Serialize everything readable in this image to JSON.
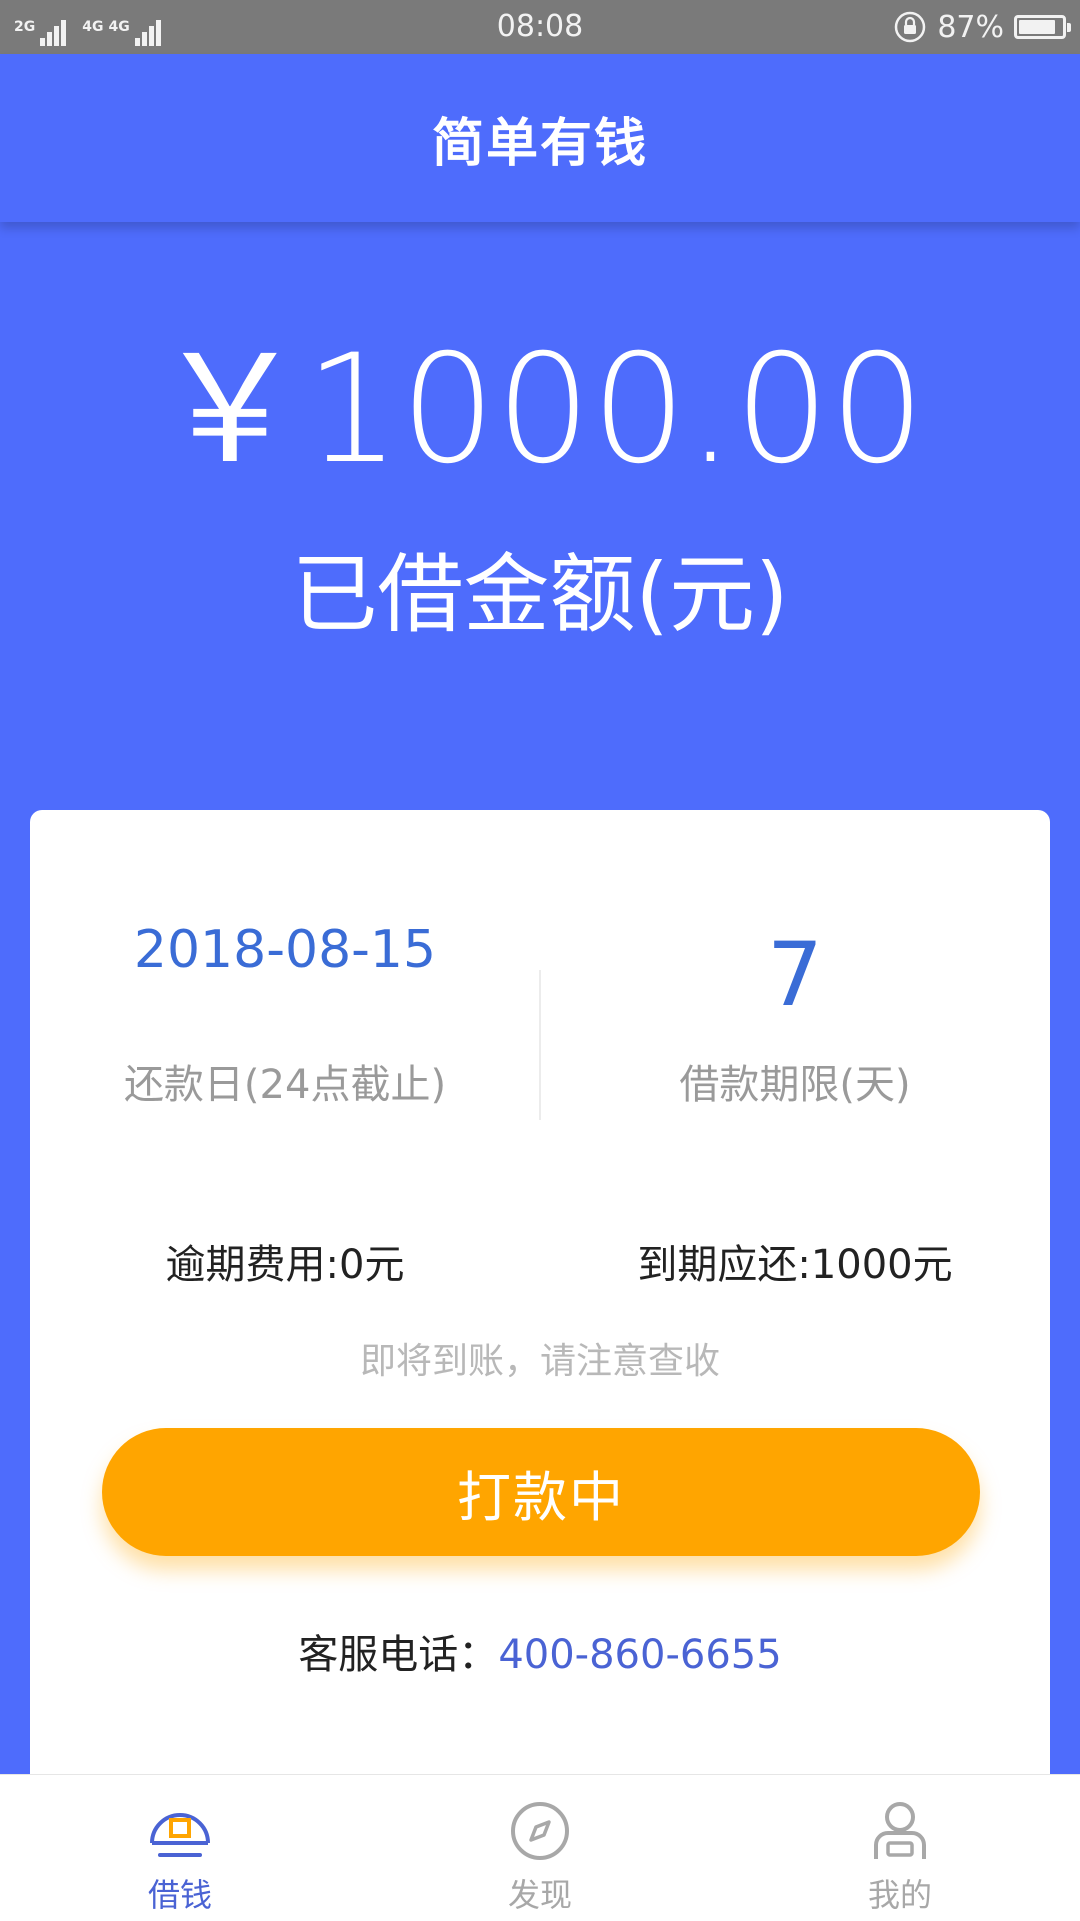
{
  "status_bar": {
    "network_1": "2G",
    "network_2": "4G",
    "network_3": "4G",
    "time": "08:08",
    "battery_percent": "87%",
    "battery_level": 0.87
  },
  "app_bar": {
    "title": "简单有钱"
  },
  "loan": {
    "amount": "￥1000.00",
    "amount_label": "已借金额(元)"
  },
  "details": {
    "repay_date": "2018-08-15",
    "repay_date_label": "还款日(24点截止)",
    "term_days": "7",
    "term_label": "借款期限(天)",
    "overdue_fee": "逾期费用:0元",
    "due_amount": "到期应还:1000元",
    "notice": "即将到账，请注意查收",
    "status_button": "打款中",
    "hotline_label": "客服电话：",
    "hotline_number": "400-860-6655"
  },
  "bottom_nav": {
    "items": [
      {
        "label": "借钱",
        "icon": "wallet-icon",
        "active": true
      },
      {
        "label": "发现",
        "icon": "compass-icon",
        "active": false
      },
      {
        "label": "我的",
        "icon": "person-icon",
        "active": false
      }
    ]
  },
  "colors": {
    "primary": "#4e6cfc",
    "accent": "#ffa500",
    "nav_active": "#4a63d4",
    "nav_active_icon_accent": "#ffa500",
    "nav_inactive": "#a8a8a8",
    "date_text": "#3a6cd6"
  }
}
